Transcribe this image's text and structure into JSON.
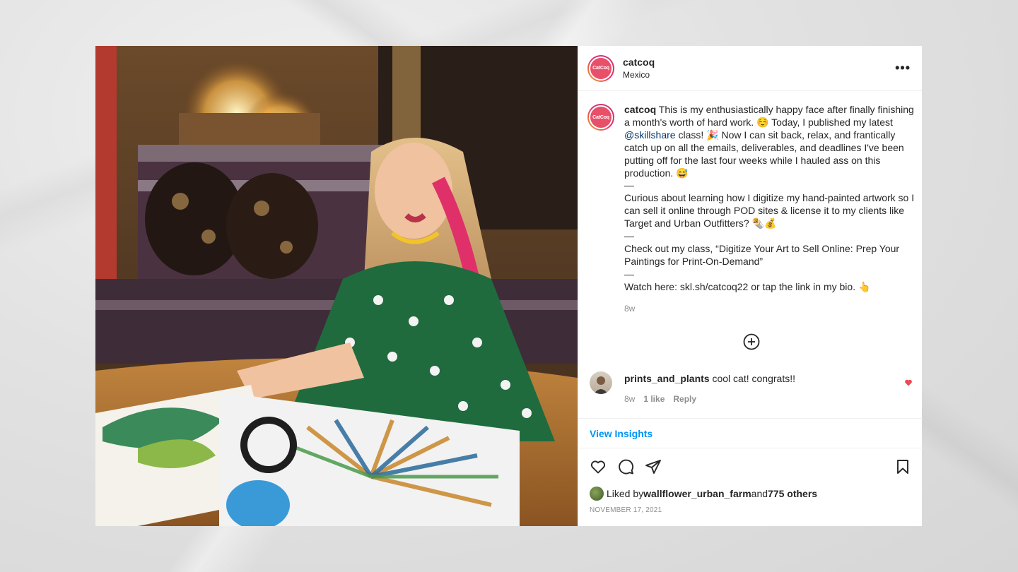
{
  "post": {
    "username": "catcoq",
    "location": "Mexico",
    "avatar_text": "CatCoq",
    "more_label": "•••"
  },
  "caption": {
    "username": "catcoq",
    "part1": " This is my enthusiastically happy face after finally finishing a month's worth of hard work. ☺️ Today, I published my latest ",
    "mention": "@skillshare",
    "part2": " class! 🎉 Now I can sit back, relax, and frantically catch up on all the emails, deliverables, and deadlines I've been putting off for the last four weeks while I hauled ass on this production. 😅",
    "dash1": "—",
    "para2": "Curious about learning how I digitize my hand-painted artwork so I can sell it online through POD sites & license it to my clients like Target and Urban Outfitters? 🌯💰",
    "dash2": "—",
    "para3": "Check out my class, “Digitize Your Art to Sell Online: Prep Your Paintings for Print-On-Demand”",
    "dash3": "—",
    "para4": "Watch here: skl.sh/catcoq22 or tap the link in my bio. 👆",
    "time": "8w"
  },
  "comment": {
    "username": "prints_and_plants",
    "text": " cool cat! congrats!!",
    "time": "8w",
    "likes": "1 like",
    "reply": "Reply"
  },
  "insights_label": "View Insights",
  "likes": {
    "prefix": "Liked by ",
    "user": "wallflower_urban_farm",
    "middle": " and ",
    "count": "775 others"
  },
  "date": "NOVEMBER 17, 2021",
  "colors": {
    "link_blue": "#0095f6",
    "mention": "#00376b",
    "heart": "#ed4956"
  }
}
